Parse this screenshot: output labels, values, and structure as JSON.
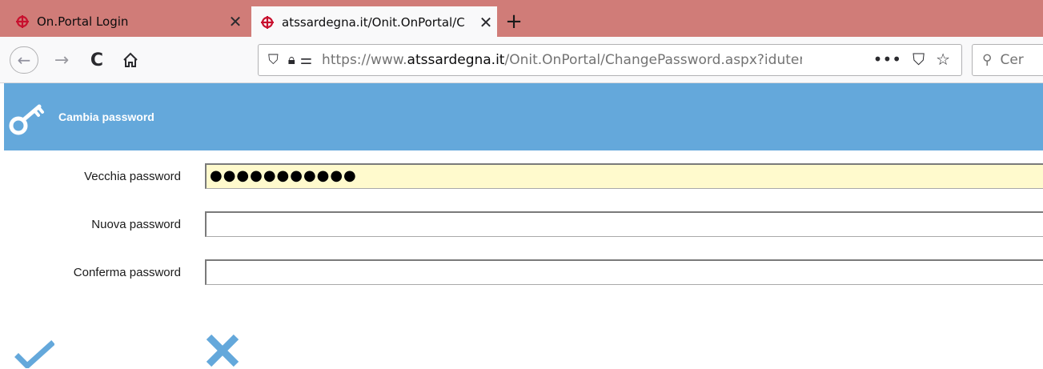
{
  "browser": {
    "tabs": [
      {
        "title": "On.Portal Login",
        "active": false,
        "favicon": "onit-logo-icon"
      },
      {
        "title": "atssardegna.it/Onit.OnPortal/C",
        "active": true,
        "favicon": "onit-logo-icon"
      }
    ],
    "url_prefix": "https://www.",
    "url_domain": "atssardegna.it",
    "url_path": "/Onit.OnPortal/ChangePassword.aspx?idutente",
    "search_placeholder": "Cer",
    "colors": {
      "tabbar": "#d07c78",
      "header": "#64a8db"
    }
  },
  "header": {
    "title": "Cambia password",
    "icon": "key-icon"
  },
  "form": {
    "old_password_label": "Vecchia password",
    "old_password_value": "●●●●●●●●●●●",
    "new_password_label": "Nuova password",
    "new_password_value": "",
    "confirm_password_label": "Conferma password",
    "confirm_password_value": ""
  },
  "actions": {
    "confirm_icon": "checkmark-icon",
    "cancel_icon": "x-icon"
  }
}
